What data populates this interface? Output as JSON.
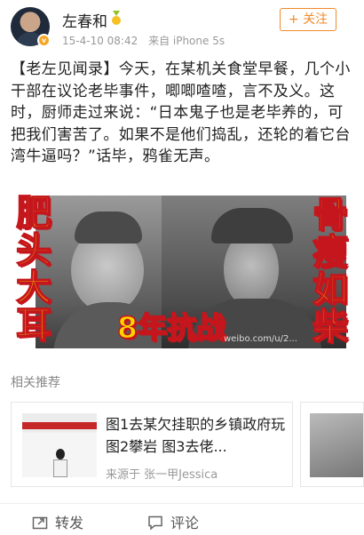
{
  "header": {
    "username": "左春和",
    "verified_badge": "v",
    "timestamp": "15-4-10 08:42",
    "source": "来自 iPhone 5s",
    "follow_label": "+ 关注"
  },
  "post": {
    "text": "【老左见闻录】今天，在某机关食堂早餐，几个小干部在议论老毕事件，唧唧喳喳，言不及义。这时，厨师走过来说：“日本鬼子也是老毕养的，可把我们害苦了。如果不是他们捣乱，还轮的着它台湾牛逼吗？”话毕，鸦雀无声。"
  },
  "image": {
    "left_caption": "肥头大耳",
    "right_caption": "骨瘦如柴",
    "center_caption": "8年抗战",
    "watermark": "weibo.com/u/2..."
  },
  "related": {
    "title": "相关推荐",
    "card_text": "图1去某欠挂职的乡镇政府玩 图2攀岩 图3去佬...",
    "card_source": "来源于 张一甲Jessica"
  },
  "actions": {
    "repost_label": "转发",
    "comment_label": "评论"
  },
  "colors": {
    "accent": "#f08a2a",
    "caption_fill": "#ffd400",
    "caption_stroke": "#c4161c"
  }
}
